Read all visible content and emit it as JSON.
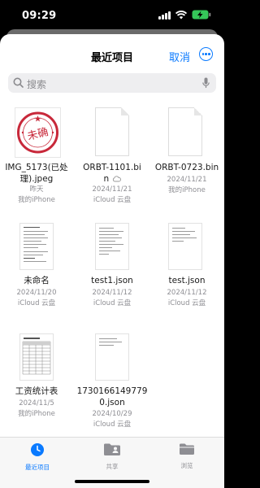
{
  "status": {
    "time": "09:29"
  },
  "nav": {
    "title": "最近项目",
    "cancel": "取消"
  },
  "search": {
    "placeholder": "搜索"
  },
  "files": [
    {
      "name": "IMG_5173(已处理).jpeg",
      "name_line1": "IMG_5173(已处",
      "name_line2": "理).jpeg",
      "date": "昨天",
      "location": "我的iPhone",
      "thumb": "stamp"
    },
    {
      "name": "ORBT-1101.bin",
      "name_line1": "ORBT-1101.bi",
      "name_line2": "n",
      "date": "2024/11/21",
      "location": "iCloud 云盘",
      "thumb": "blank",
      "cloud_icon": "cloud-icon"
    },
    {
      "name": "ORBT-0723.bin",
      "name_line1": "ORBT-0723.bin",
      "date": "2024/11/21",
      "location": "我的iPhone",
      "thumb": "blank"
    },
    {
      "name": "未命名",
      "name_line1": "未命名",
      "date": "2024/11/20",
      "location": "iCloud 云盘",
      "thumb": "text"
    },
    {
      "name": "test1.json",
      "name_line1": "test1.json",
      "date": "2024/11/12",
      "location": "iCloud 云盘",
      "thumb": "text"
    },
    {
      "name": "test.json",
      "name_line1": "test.json",
      "date": "2024/11/12",
      "location": "iCloud 云盘",
      "thumb": "text"
    },
    {
      "name": "工资统计表",
      "name_line1": "工资统计表",
      "date": "2024/11/5",
      "location": "我的iPhone",
      "thumb": "sheet"
    },
    {
      "name": "1730166149779 0.json",
      "name_line1": "1730166149779",
      "name_line2": "0.json",
      "date": "2024/10/29",
      "location": "iCloud 云盘",
      "thumb": "text"
    }
  ],
  "stamp": {
    "text": "未确"
  },
  "tabs": [
    {
      "label": "最近项目",
      "icon": "clock-icon",
      "active": true
    },
    {
      "label": "共享",
      "icon": "shared-folder-icon",
      "active": false
    },
    {
      "label": "浏览",
      "icon": "folder-icon",
      "active": false
    }
  ],
  "colors": {
    "accent": "#0a7aff",
    "stamp": "#c8283a"
  }
}
